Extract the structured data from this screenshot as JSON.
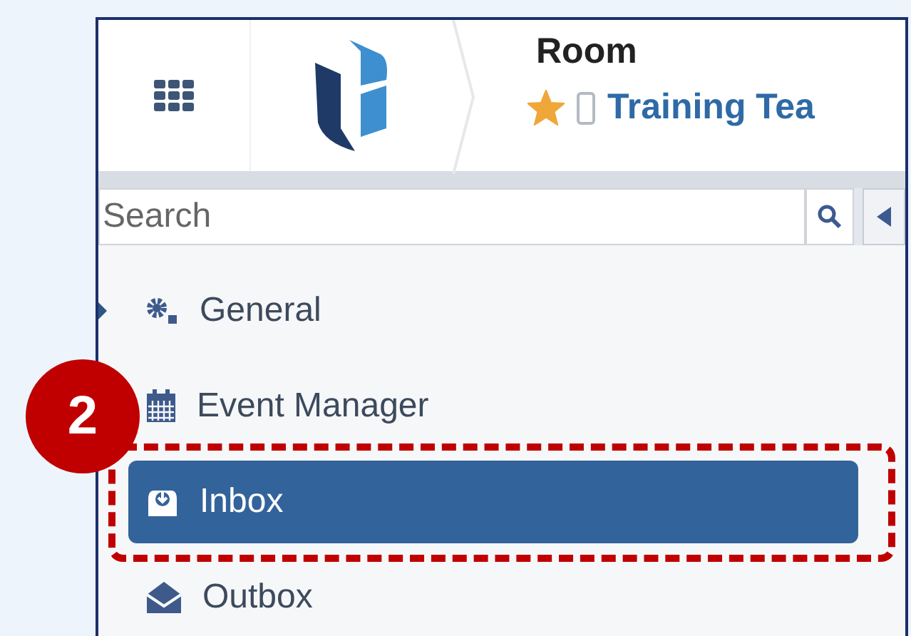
{
  "header": {
    "room_label": "Room",
    "favorite": true,
    "room_name": "Training Tea"
  },
  "search": {
    "placeholder": "Search"
  },
  "menu": [
    {
      "label": "General",
      "has_children": true,
      "selected": false
    },
    {
      "label": "Event Manager",
      "has_children": false,
      "selected": false
    },
    {
      "label": "Inbox",
      "has_children": false,
      "selected": true
    },
    {
      "label": "Outbox",
      "has_children": false,
      "selected": false
    }
  ],
  "callout": {
    "number": "2"
  }
}
